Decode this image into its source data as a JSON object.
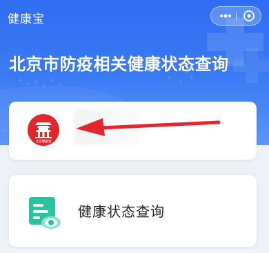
{
  "app": {
    "title": "健康宝"
  },
  "capsule": {
    "more_icon": "more-dots-icon",
    "close_icon": "close-mini-program-icon"
  },
  "hero": {
    "headline": "北京市防疫相关健康状态查询"
  },
  "cards": {
    "app_card": {
      "logo_icon": "beijing-health-kit-logo",
      "logo_text": "北京健康宝"
    },
    "query_card": {
      "icon": "health-status-icon",
      "label": "健康状态查询"
    }
  },
  "colors": {
    "hero_blue": "#2f6df2",
    "accent_red": "#e3262b",
    "query_green": "#2bc2a0"
  }
}
